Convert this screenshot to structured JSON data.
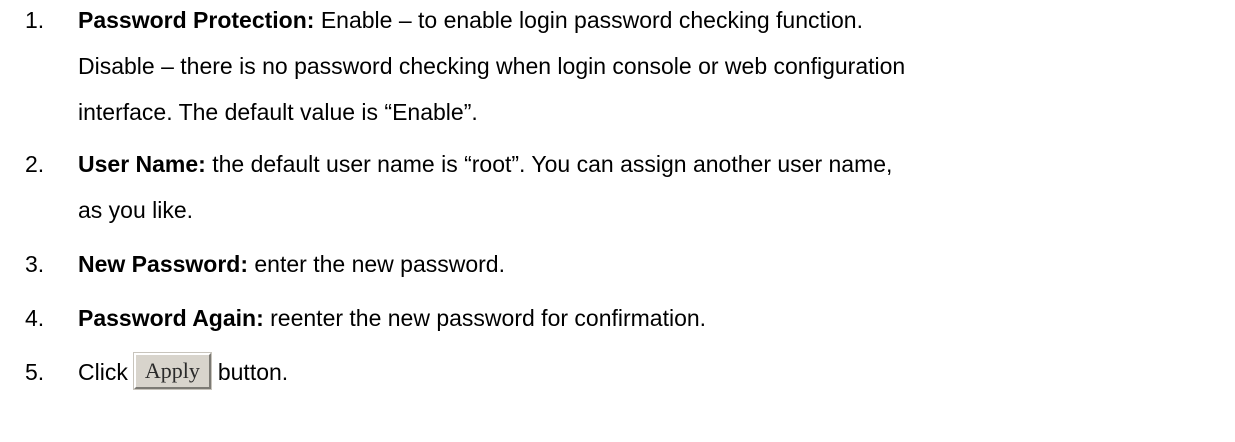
{
  "items": [
    {
      "number": "1.",
      "term": "Password Protection:",
      "lines": [
        " Enable – to enable login password checking function.",
        "Disable – there is no password checking when login console or web configuration",
        "interface. The default value is “Enable”."
      ]
    },
    {
      "number": "2.",
      "term": "User Name:",
      "lines": [
        " the default user name is “root”. You can assign another user name,",
        "as you like."
      ]
    },
    {
      "number": "3.",
      "term": "New Password:",
      "lines": [
        " enter the new password."
      ]
    },
    {
      "number": "4.",
      "term": "Password Again:",
      "lines": [
        " reenter the new password for confirmation."
      ]
    },
    {
      "number": "5.",
      "before_button": "Click",
      "button_label": "Apply",
      "after_button": "button."
    }
  ]
}
